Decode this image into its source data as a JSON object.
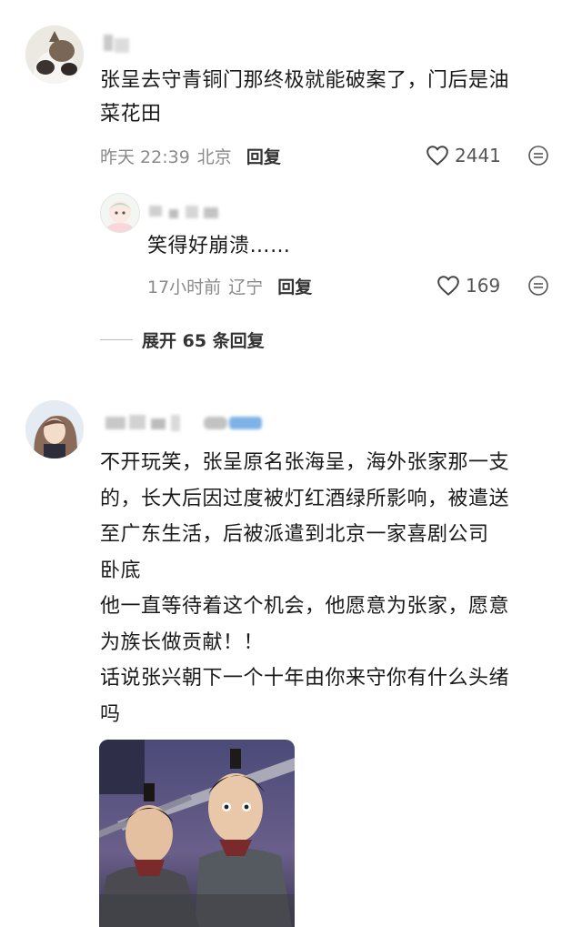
{
  "comments": [
    {
      "lines": [
        "张呈去守青铜门那终极就能破案了，门后是油",
        "菜花田"
      ],
      "time": "昨天 22:39",
      "location": "北京",
      "reply_label": "回复",
      "likes": "2441",
      "replies": [
        {
          "text": "笑得好崩溃……",
          "time": "17小时前",
          "location": "辽宁",
          "reply_label": "回复",
          "likes": "169"
        }
      ],
      "expand_label": "展开 65 条回复"
    },
    {
      "lines": [
        "不开玩笑，张呈原名张海呈，海外张家那一支",
        "的，长大后因过度被灯红酒绿所影响，被遣送",
        "至广东生活，后被派遣到北京一家喜剧公司",
        "卧底",
        "他一直等待着这个机会，他愿意为张家，愿意",
        "为族长做贡献！！",
        "话说张兴朝下一个十年由你来守你有什么头绪",
        "吗"
      ]
    }
  ],
  "icons": {
    "like": "heart-outline-icon",
    "more": "more-circle-icon"
  }
}
